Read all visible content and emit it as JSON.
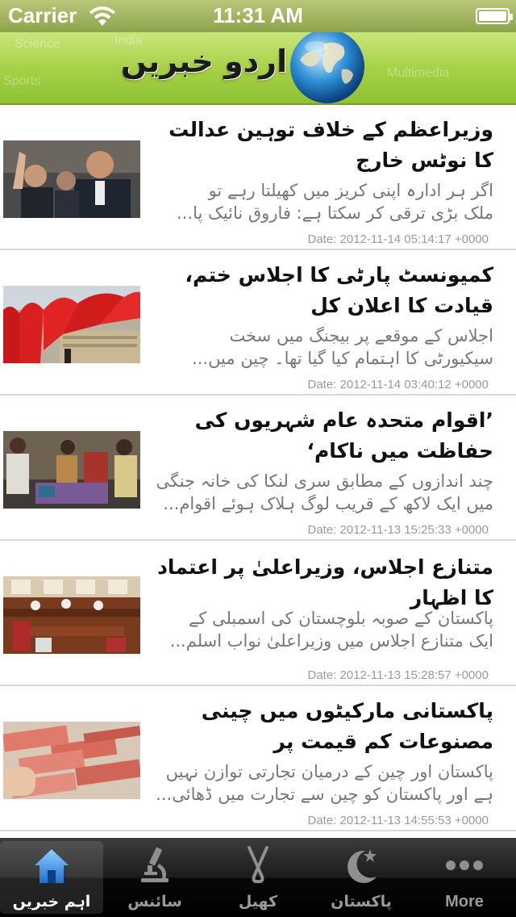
{
  "status_bar": {
    "carrier": "Carrier",
    "time": "11:31 AM"
  },
  "header": {
    "title": "اردو خبریں",
    "bg_words": [
      "Science",
      "India",
      "Sports",
      "Multimedia"
    ]
  },
  "news": [
    {
      "title": "وزیراعظم کے خلاف توہین عدالت کا نوٹس خارج",
      "summary_lines": [
        "اگر ہر ادارہ اپنی کریز میں کھیلتا رہے تو",
        "ملک بڑی ترقی کر سکتا ہے: فاروق نائیک      پا..."
      ],
      "date": "Date: 2012-11-14 05:14:17 +0000"
    },
    {
      "title": "کمیونسٹ پارٹی کا اجلاس ختم، قیادت کا اعلان کل",
      "summary_lines": [
        "اجلاس کے موقعے پر بیجنگ میں سخت",
        "سیکیورٹی کا اہتمام کیا گیا تھا۔      چین میں..."
      ],
      "date": "Date: 2012-11-14 03:40:12 +0000"
    },
    {
      "title": "’اقوام متحدہ عام شہریوں کی حفاظت میں ناکام‘",
      "summary_lines": [
        "چند اندازوں کے مطابق سری لنکا کی خانہ جنگی",
        "میں ایک لاکھ کے قریب لوگ ہلاک ہوئے      اقوام..."
      ],
      "date": "Date: 2012-11-13 15:25:33 +0000"
    },
    {
      "title": "متنازع اجلاس، وزیراعلیٰ پر اعتماد کا اظہار",
      "summary_lines": [
        "پاکستان کے صوبہ بلوچستان کی اسمبلی کے",
        "ایک متنازع اجلاس میں وزیراعلیٰ نواب اسلم..."
      ],
      "date": "Date: 2012-11-13 15:28:57 +0000"
    },
    {
      "title": "پاکستانی مارکیٹوں میں چینی مصنوعات کم قیمت پر",
      "summary_lines": [
        "پاکستان اور چین کے درمیان تجارتی توازن نہیں",
        "ہے اور پاکستان کو چین سے تجارت میں ڈھائی..."
      ],
      "date": "Date: 2012-11-13 14:55:53 +0000"
    }
  ],
  "tabs": [
    {
      "label": "اہم خبریں",
      "icon": "home-icon",
      "active": true
    },
    {
      "label": "سائنس",
      "icon": "microscope-icon",
      "active": false
    },
    {
      "label": "کھیل",
      "icon": "hockey-sticks-icon",
      "active": false
    },
    {
      "label": "پاکستان",
      "icon": "crescent-star-icon",
      "active": false
    },
    {
      "label": "More",
      "icon": "more-icon",
      "active": false
    }
  ],
  "colors": {
    "header_green": "#a4cf43",
    "tab_active": "#3f8fe0",
    "summary_gray": "#777777"
  }
}
